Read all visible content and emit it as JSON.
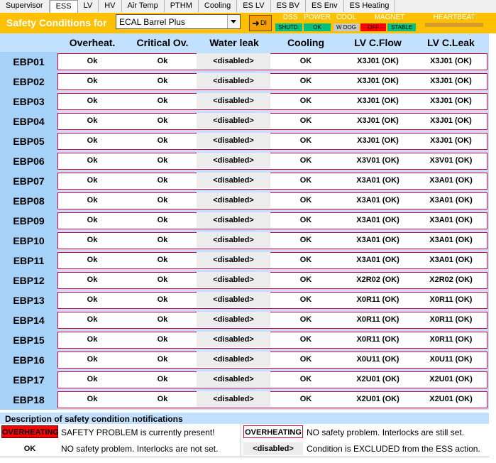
{
  "tabs": [
    "Supervisor",
    "ESS",
    "LV",
    "HV",
    "Air Temp",
    "PTHM",
    "Cooling",
    "ES LV",
    "ES BV",
    "ES Env",
    "ES Heating"
  ],
  "active_tab": "ESS",
  "title": "Safety Conditions for",
  "dropdown_value": "ECAL Barrel Plus",
  "di_button": "DI",
  "indicators": {
    "dss_label": "DSS",
    "dss_status": "SHUTD.",
    "power_label": "POWER",
    "power_status": "OK",
    "cool_label": "COOL",
    "cool_status": "W DOG",
    "magnet_label": "MAGNET",
    "magnet_status_1": "OFF",
    "magnet_status_2": "STABLE",
    "heartbeat_label": "HEARTBEAT"
  },
  "colors": {
    "accent": "#ffc000",
    "error": "#ff0000",
    "ok_green": "#00c080",
    "header_blue": "#c2e0ff",
    "label_blue": "#a6d1f9"
  },
  "columns": [
    "Overheat.",
    "Critical Ov.",
    "Water leak",
    "Cooling",
    "LV C.Flow",
    "LV C.Leak"
  ],
  "rows": [
    {
      "id": "EBP01",
      "c": [
        "Ok",
        "Ok",
        "<disabled>",
        "OK",
        "X3J01 (OK)",
        "X3J01 (OK)"
      ]
    },
    {
      "id": "EBP02",
      "c": [
        "Ok",
        "Ok",
        "<disabled>",
        "OK",
        "X3J01 (OK)",
        "X3J01 (OK)"
      ]
    },
    {
      "id": "EBP03",
      "c": [
        "Ok",
        "Ok",
        "<disabled>",
        "OK",
        "X3J01 (OK)",
        "X3J01 (OK)"
      ]
    },
    {
      "id": "EBP04",
      "c": [
        "Ok",
        "Ok",
        "<disabled>",
        "OK",
        "X3J01 (OK)",
        "X3J01 (OK)"
      ]
    },
    {
      "id": "EBP05",
      "c": [
        "Ok",
        "Ok",
        "<disabled>",
        "OK",
        "X3J01 (OK)",
        "X3J01 (OK)"
      ]
    },
    {
      "id": "EBP06",
      "c": [
        "Ok",
        "Ok",
        "<disabled>",
        "OK",
        "X3V01 (OK)",
        "X3V01 (OK)"
      ]
    },
    {
      "id": "EBP07",
      "c": [
        "Ok",
        "Ok",
        "<disabled>",
        "OK",
        "X3A01 (OK)",
        "X3A01 (OK)"
      ]
    },
    {
      "id": "EBP08",
      "c": [
        "Ok",
        "Ok",
        "<disabled>",
        "OK",
        "X3A01 (OK)",
        "X3A01 (OK)"
      ]
    },
    {
      "id": "EBP09",
      "c": [
        "Ok",
        "Ok",
        "<disabled>",
        "OK",
        "X3A01 (OK)",
        "X3A01 (OK)"
      ]
    },
    {
      "id": "EBP10",
      "c": [
        "Ok",
        "Ok",
        "<disabled>",
        "OK",
        "X3A01 (OK)",
        "X3A01 (OK)"
      ]
    },
    {
      "id": "EBP11",
      "c": [
        "Ok",
        "Ok",
        "<disabled>",
        "OK",
        "X3A01 (OK)",
        "X3A01 (OK)"
      ]
    },
    {
      "id": "EBP12",
      "c": [
        "Ok",
        "Ok",
        "<disabled>",
        "OK",
        "X2R02 (OK)",
        "X2R02 (OK)"
      ]
    },
    {
      "id": "EBP13",
      "c": [
        "Ok",
        "Ok",
        "<disabled>",
        "OK",
        "X0R11 (OK)",
        "X0R11 (OK)"
      ]
    },
    {
      "id": "EBP14",
      "c": [
        "Ok",
        "Ok",
        "<disabled>",
        "OK",
        "X0R11 (OK)",
        "X0R11 (OK)"
      ]
    },
    {
      "id": "EBP15",
      "c": [
        "Ok",
        "Ok",
        "<disabled>",
        "OK",
        "X0R11 (OK)",
        "X0R11 (OK)"
      ]
    },
    {
      "id": "EBP16",
      "c": [
        "Ok",
        "Ok",
        "<disabled>",
        "OK",
        "X0U11 (OK)",
        "X0U11 (OK)"
      ]
    },
    {
      "id": "EBP17",
      "c": [
        "Ok",
        "Ok",
        "<disabled>",
        "OK",
        "X2U01 (OK)",
        "X2U01 (OK)"
      ]
    },
    {
      "id": "EBP18",
      "c": [
        "Ok",
        "Ok",
        "<disabled>",
        "OK",
        "X2U01 (OK)",
        "X2U01 (OK)"
      ]
    }
  ],
  "description": {
    "title": "Description of safety condition notifications",
    "items": [
      {
        "badge": "OVERHEATING",
        "text": "SAFETY PROBLEM is currently present!"
      },
      {
        "badge": "OVERHEATING",
        "text": "NO safety problem. Interlocks are still set."
      },
      {
        "badge": "OK",
        "text": "NO safety problem. Interlocks are not set."
      },
      {
        "badge": "<disabled>",
        "text": "Condition is EXCLUDED from the ESS action."
      }
    ]
  }
}
